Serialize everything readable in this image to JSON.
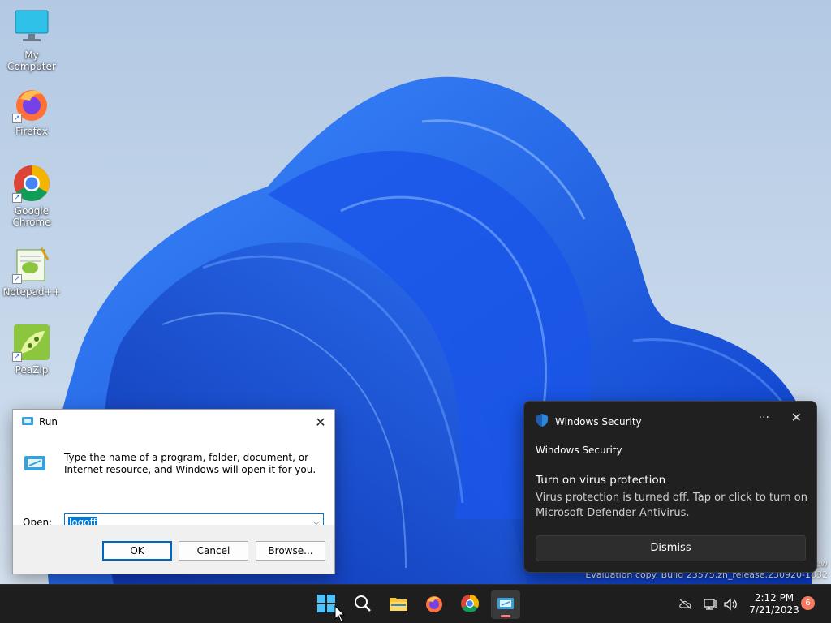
{
  "desktop": {
    "icons": [
      {
        "label": "My Computer",
        "icon": "monitor-icon"
      },
      {
        "label": "Firefox",
        "icon": "firefox-icon"
      },
      {
        "label": "Google Chrome",
        "icon": "chrome-icon"
      },
      {
        "label": "Notepad++",
        "icon": "notepadpp-icon"
      },
      {
        "label": "PeaZip",
        "icon": "peazip-icon"
      }
    ]
  },
  "run_dialog": {
    "title": "Run",
    "message": "Type the name of a program, folder, document, or Internet resource, and Windows will open it for you.",
    "open_label": "Open:",
    "open_value": "logoff",
    "ok_label": "OK",
    "cancel_label": "Cancel",
    "browse_label": "Browse..."
  },
  "toast": {
    "header_title": "Windows Security",
    "app_name": "Windows Security",
    "title": "Turn on virus protection",
    "body": "Virus protection is turned off. Tap or click to turn on Microsoft Defender Antivirus.",
    "dismiss_label": "Dismiss",
    "more_glyph": "···",
    "close_glyph": "✕"
  },
  "watermark": {
    "line1": "ew",
    "line2": "Evaluation copy. Build 23575.zn_release.230920-1832"
  },
  "taskbar": {
    "pinned": [
      "start-icon",
      "search-icon",
      "file-explorer-icon",
      "firefox-icon",
      "chrome-icon",
      "run-icon"
    ],
    "clock_time": "2:12 PM",
    "clock_date": "7/21/2023",
    "notification_count": "6"
  },
  "colors": {
    "accent": "#0078d4",
    "taskbar": "#1e1e1e",
    "toast_bg": "#202020"
  }
}
